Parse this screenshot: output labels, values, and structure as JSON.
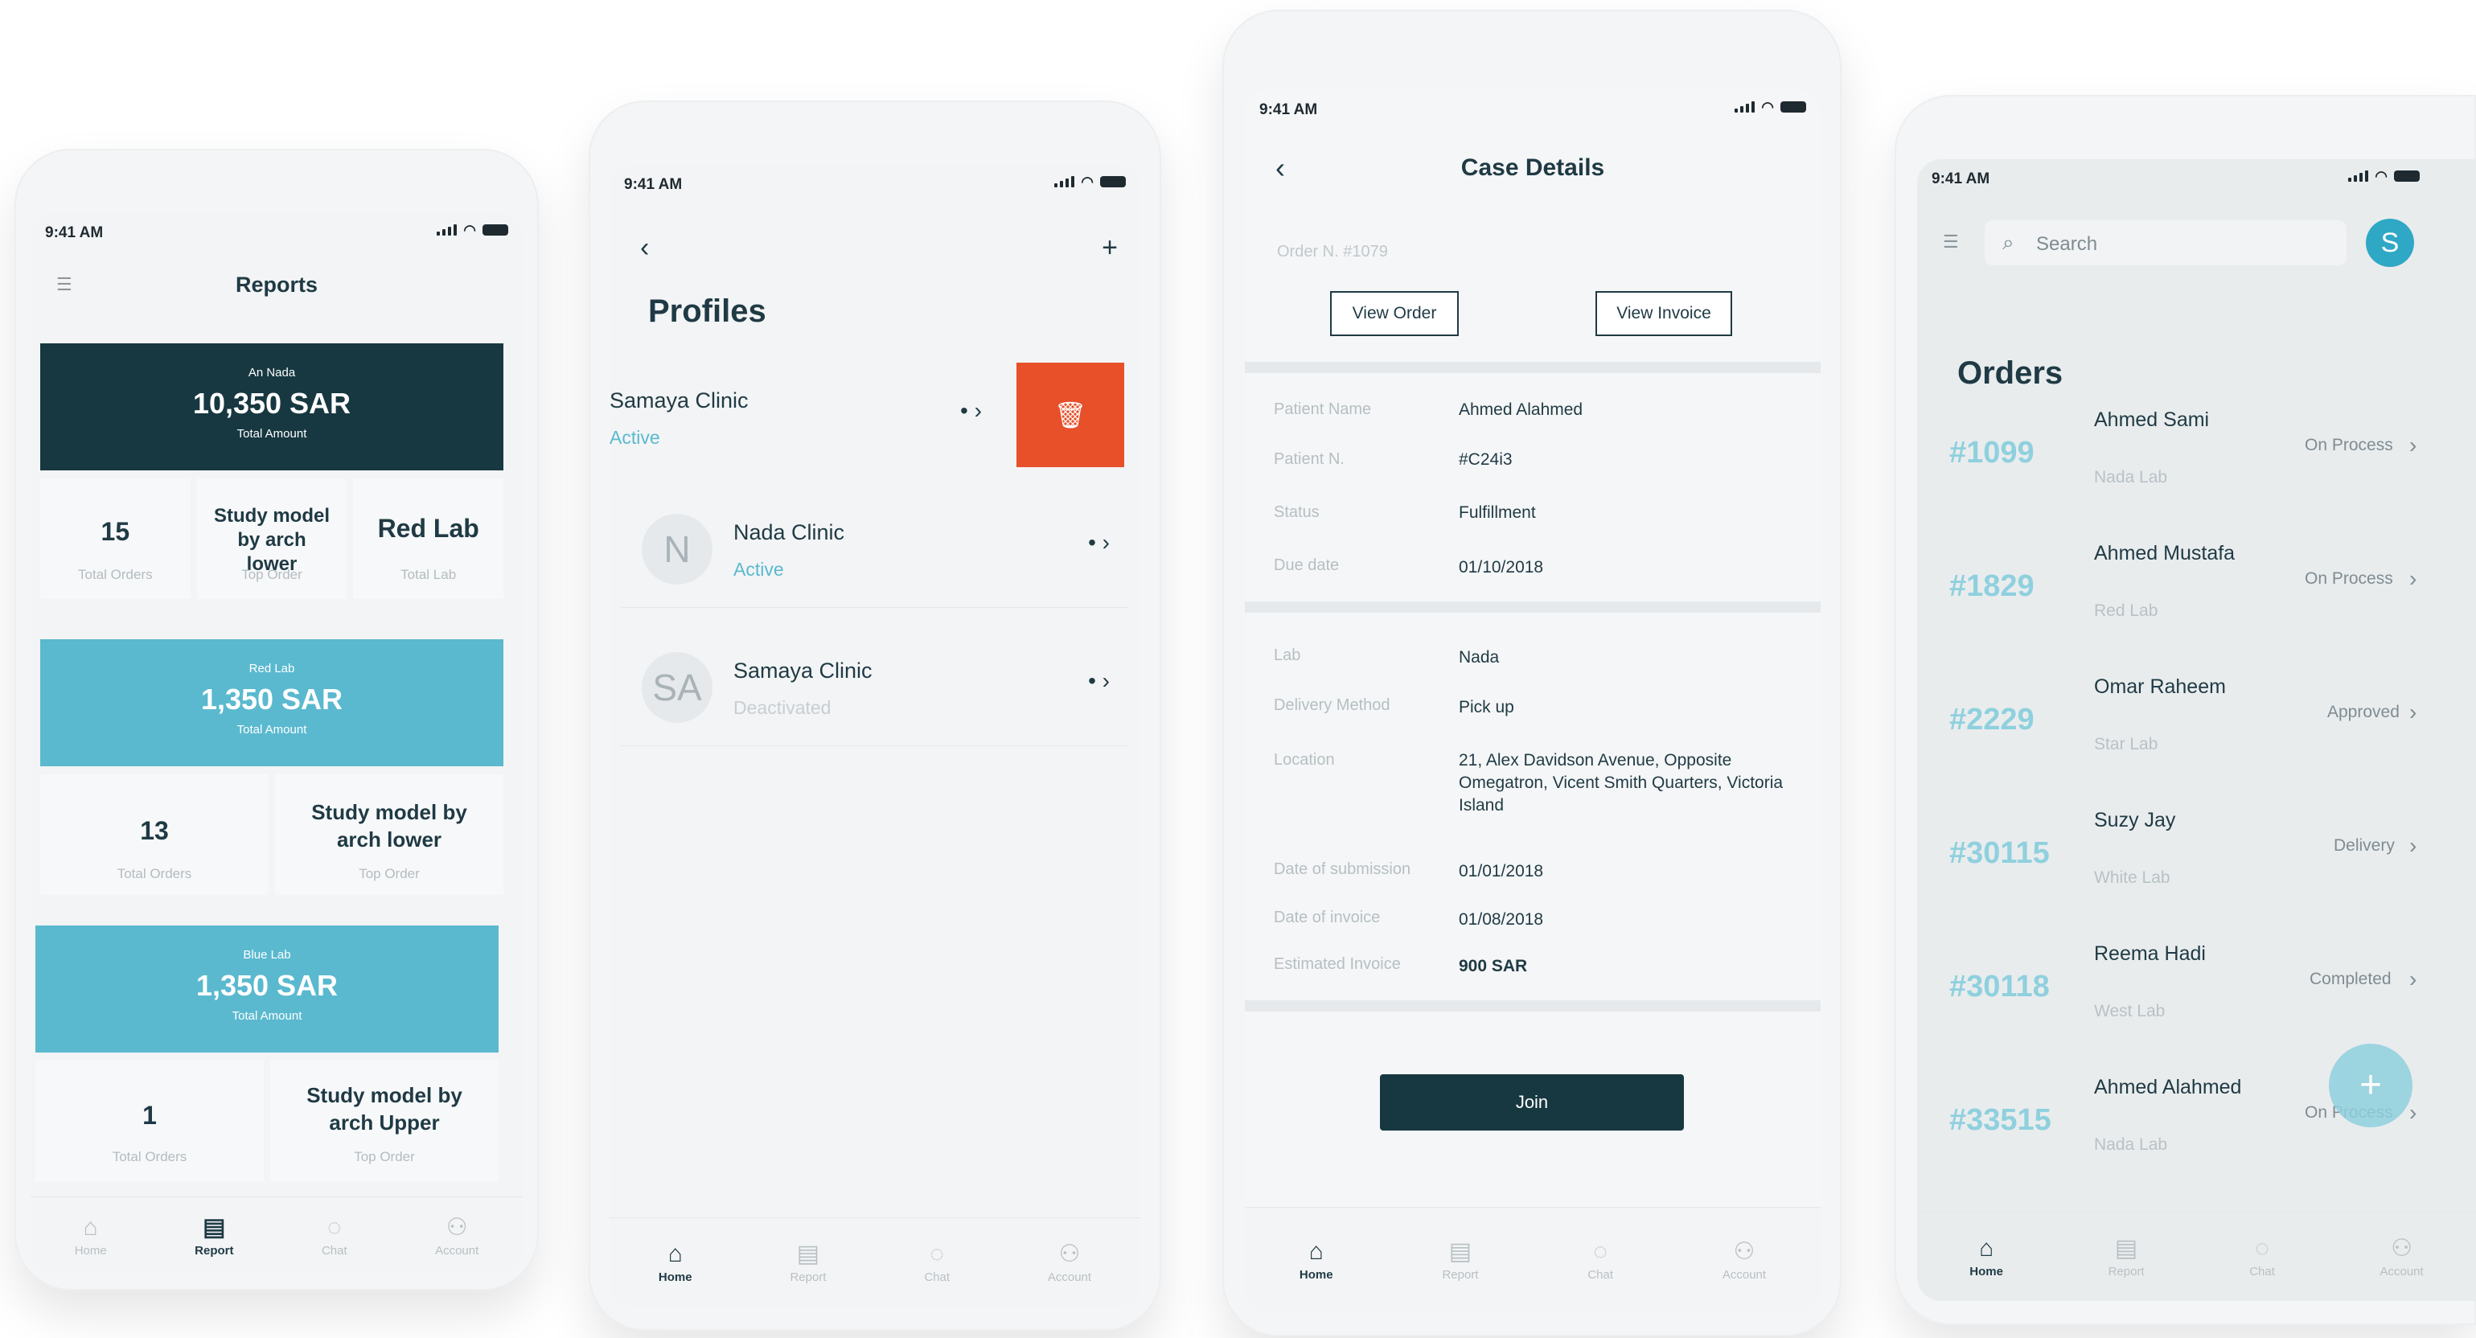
{
  "status_time": "9:41 AM",
  "tabs": {
    "home": "Home",
    "report": "Report",
    "chat": "Chat",
    "account": "Account"
  },
  "icons": {
    "filter": "filter-icon",
    "back": "back-chevron-icon",
    "add": "plus-icon",
    "trash": "trash-icon",
    "search": "search-icon"
  },
  "colors": {
    "dark": "#173841",
    "accent": "#5ab9cf",
    "danger": "#e8502a",
    "active": "#5ab9cf"
  },
  "reports": {
    "title": "Reports",
    "card1": {
      "name": "An Nada",
      "amount": "10,350 SAR",
      "sub": "Total Amount"
    },
    "stats1": [
      {
        "value": "15",
        "label": "Total Orders"
      },
      {
        "value": "Study model by arch lower",
        "label": "Top Order"
      },
      {
        "value": "Red Lab",
        "label": "Total Lab"
      }
    ],
    "card2": {
      "name": "Red Lab",
      "amount": "1,350 SAR",
      "sub": "Total Amount"
    },
    "stats2": [
      {
        "value": "13",
        "label": "Total Orders"
      },
      {
        "value": "Study model by arch lower",
        "label": "Top Order"
      }
    ],
    "card3": {
      "name": "Blue Lab",
      "amount": "1,350 SAR",
      "sub": "Total Amount"
    },
    "stats3": [
      {
        "value": "1",
        "label": "Total Orders"
      },
      {
        "value": "Study model by arch Upper",
        "label": "Top Order"
      }
    ]
  },
  "profiles": {
    "title": "Profiles",
    "items": [
      {
        "name": "Samaya Clinic",
        "status": "Active",
        "initials": ""
      },
      {
        "name": "Nada Clinic",
        "status": "Active",
        "initials": "N"
      },
      {
        "name": "Samaya Clinic",
        "status": "Deactivated",
        "initials": "SA"
      }
    ]
  },
  "case": {
    "title": "Case Details",
    "order_no": "Order N. #1079",
    "view_order": "View Order",
    "view_invoice": "View Invoice",
    "section1": [
      {
        "label": "Patient Name",
        "value": "Ahmed Alahmed"
      },
      {
        "label": "Patient N.",
        "value": "#C24i3"
      },
      {
        "label": "Status",
        "value": "Fulfillment"
      },
      {
        "label": "Due date",
        "value": "01/10/2018"
      }
    ],
    "section2": [
      {
        "label": "Lab",
        "value": "Nada"
      },
      {
        "label": "Delivery Method",
        "value": "Pick up"
      },
      {
        "label": "Location",
        "value": "21, Alex Davidson Avenue, Opposite Omegatron, Vicent Smith Quarters, Victoria Island"
      },
      {
        "label": "Date of submission",
        "value": "01/01/2018"
      },
      {
        "label": "Date of invoice",
        "value": "01/08/2018"
      },
      {
        "label": "Estimated Invoice",
        "value": "900 SAR"
      }
    ],
    "join": "Join"
  },
  "orders": {
    "search_placeholder": "Search",
    "avatar": "S",
    "title": "Orders",
    "items": [
      {
        "id": "#1099",
        "name": "Ahmed Sami",
        "lab": "Nada Lab",
        "status": "On Process"
      },
      {
        "id": "#1829",
        "name": "Ahmed Mustafa",
        "lab": "Red Lab",
        "status": "On Process"
      },
      {
        "id": "#2229",
        "name": "Omar Raheem",
        "lab": "Star Lab",
        "status": "Approved"
      },
      {
        "id": "#30115",
        "name": "Suzy Jay",
        "lab": "White Lab",
        "status": "Delivery"
      },
      {
        "id": "#30118",
        "name": "Reema Hadi",
        "lab": "West Lab",
        "status": "Completed"
      },
      {
        "id": "#33515",
        "name": "Ahmed Alahmed",
        "lab": "Nada Lab",
        "status": "On Process"
      }
    ]
  }
}
